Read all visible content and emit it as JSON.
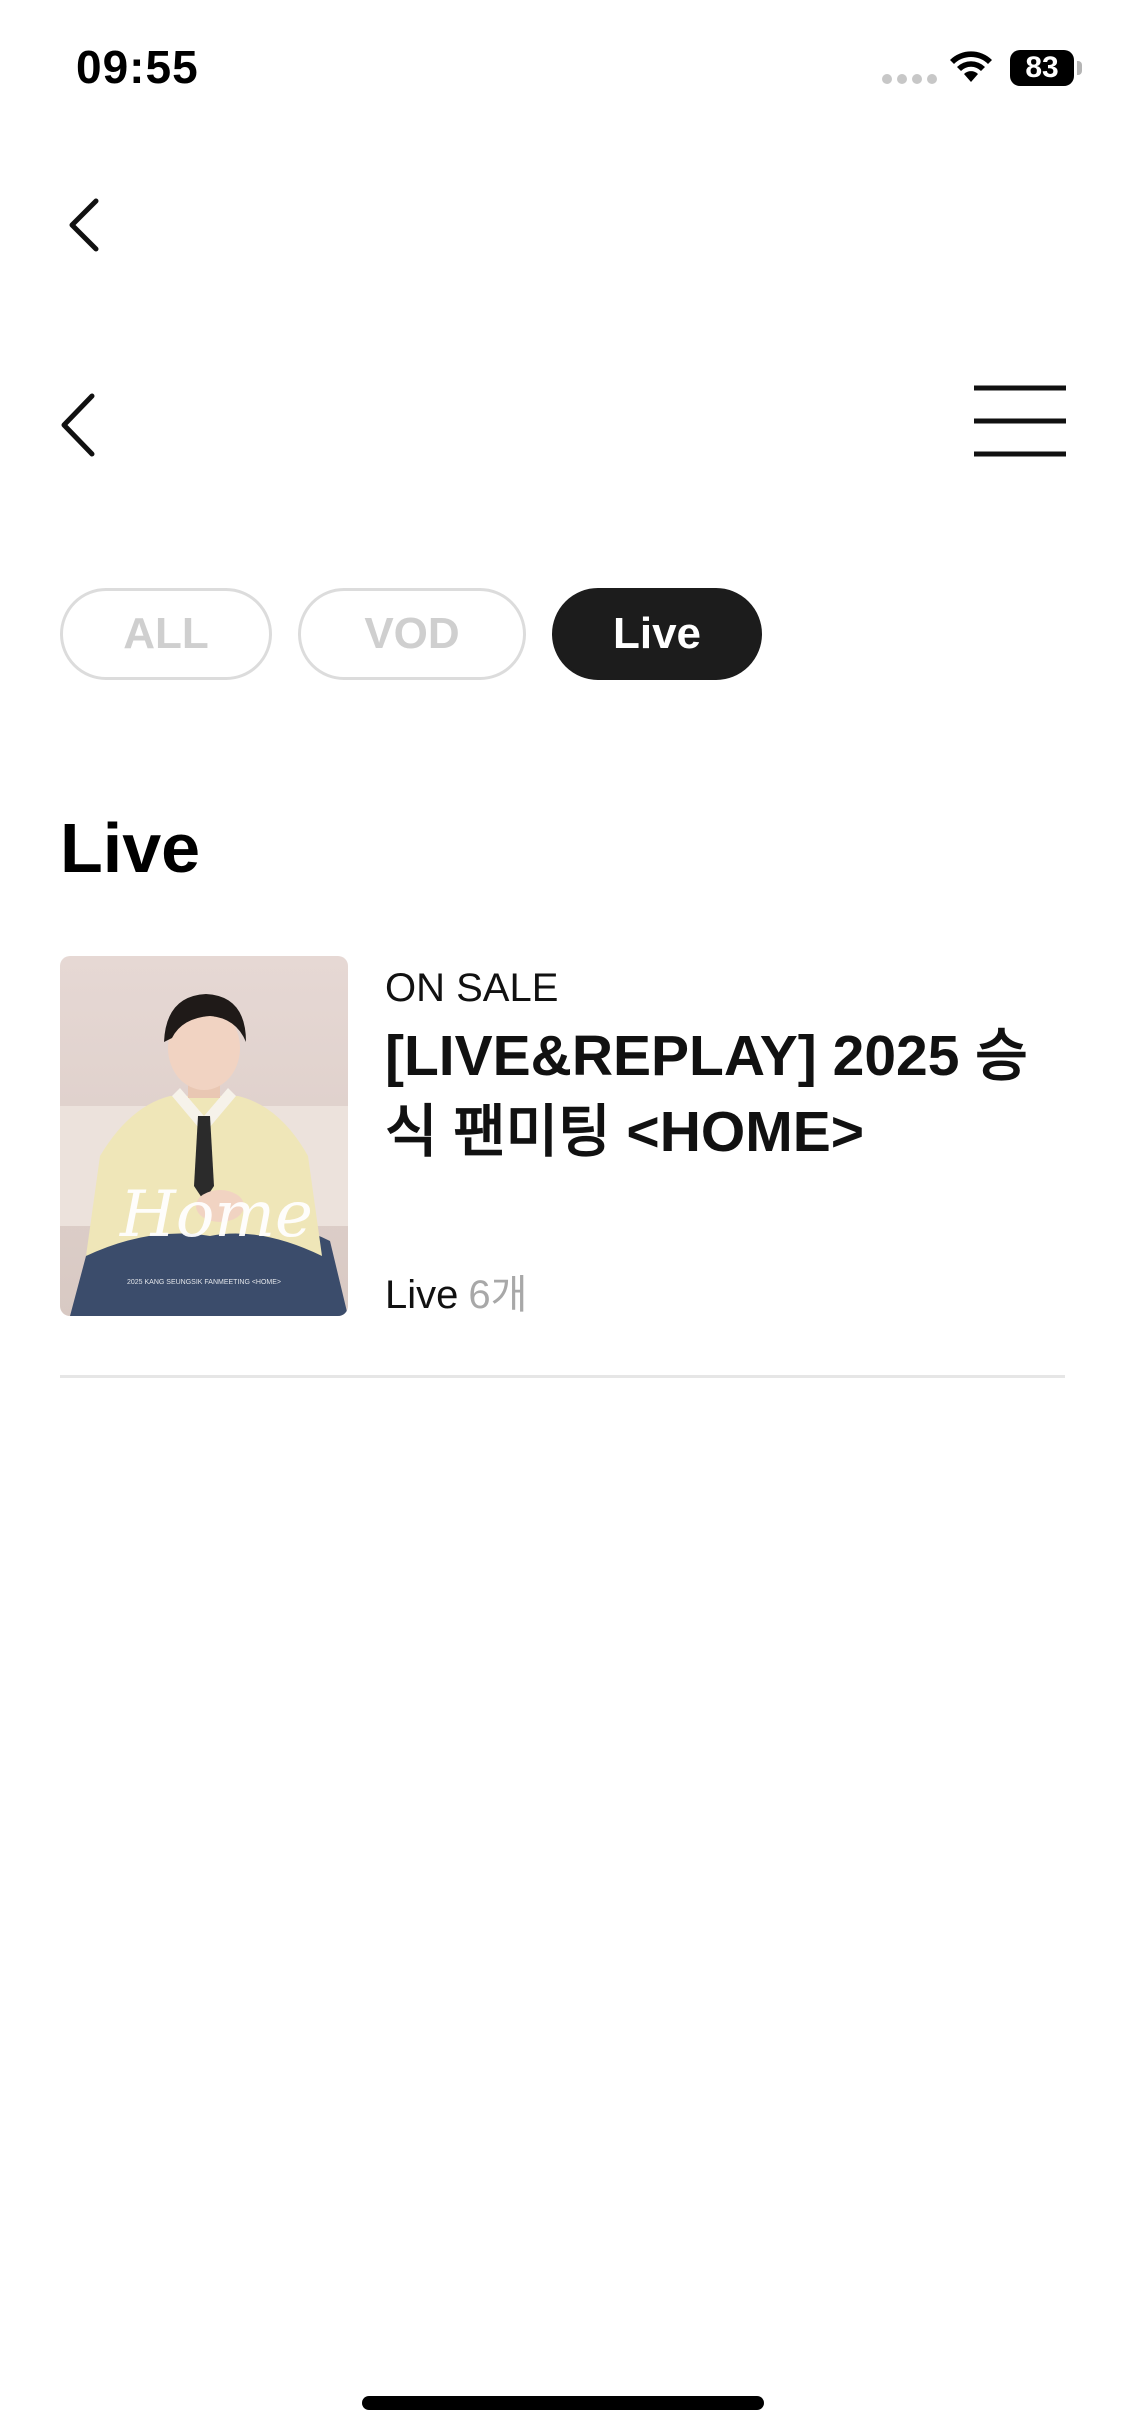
{
  "status_bar": {
    "time": "09:55",
    "battery": "83",
    "icons": [
      "signal-dots-icon",
      "wifi-icon",
      "battery-icon"
    ]
  },
  "nav": {
    "back_icon": "chevron-left-icon",
    "menu_icon": "hamburger-menu-icon"
  },
  "filters": {
    "selected": "Live",
    "items": [
      {
        "label": "ALL"
      },
      {
        "label": "VOD"
      },
      {
        "label": "Live"
      }
    ]
  },
  "section": {
    "title": "Live"
  },
  "items": [
    {
      "status": "ON SALE",
      "title": "[LIVE&REPLAY] 2025 승식 팬미팅 <HOME>",
      "type": "Live",
      "count": "6개",
      "thumbnail": {
        "script_text": "Home",
        "caption": "2025 KANG SEUNGSIK FANMEETING <HOME>"
      }
    }
  ],
  "colors": {
    "active_chip": "#1c1c1c",
    "inactive_chip_text": "#cfcfcf",
    "divider": "#e6e6e6",
    "muted_text": "#a8a8a8"
  }
}
